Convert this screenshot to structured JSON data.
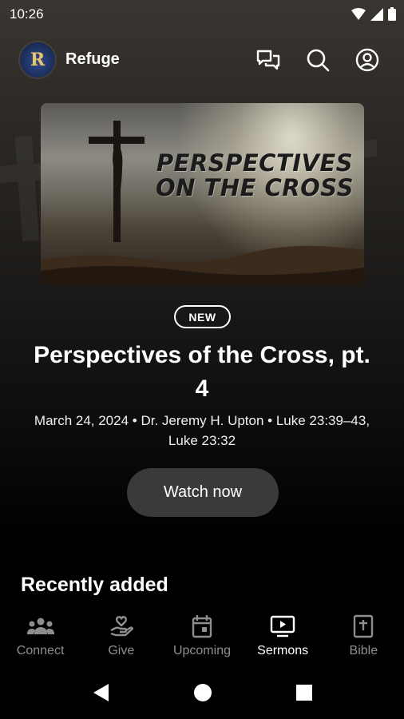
{
  "status_bar": {
    "time": "10:26",
    "icons": [
      "wifi-icon",
      "signal-icon",
      "battery-icon"
    ]
  },
  "app_bar": {
    "logo_text": "R",
    "title": "Refuge",
    "actions": [
      "chat-icon",
      "search-icon",
      "account-icon"
    ]
  },
  "hero": {
    "image_title_line1": "PERSPECTIVES",
    "image_title_line2": "ON THE CROSS"
  },
  "featured": {
    "badge": "NEW",
    "title": "Perspectives of the Cross, pt. 4",
    "meta": "March 24, 2024 • Dr. Jeremy H. Upton • Luke 23:39–43, Luke 23:32",
    "cta": "Watch now"
  },
  "sections": {
    "recently_added": "Recently added"
  },
  "bottom_nav": {
    "items": [
      {
        "label": "Connect",
        "icon": "people-icon",
        "active": false
      },
      {
        "label": "Give",
        "icon": "hand-heart-icon",
        "active": false
      },
      {
        "label": "Upcoming",
        "icon": "calendar-icon",
        "active": false
      },
      {
        "label": "Sermons",
        "icon": "play-tv-icon",
        "active": true
      },
      {
        "label": "Bible",
        "icon": "bible-icon",
        "active": false
      }
    ]
  },
  "system_nav": [
    "back-icon",
    "home-icon",
    "recents-icon"
  ],
  "colors": {
    "background_top": "#3a3530",
    "background_bottom": "#000000",
    "button_bg": "#3a3a3a",
    "nav_inactive": "#8e8e8e",
    "logo_gold": "#e9c46a"
  }
}
